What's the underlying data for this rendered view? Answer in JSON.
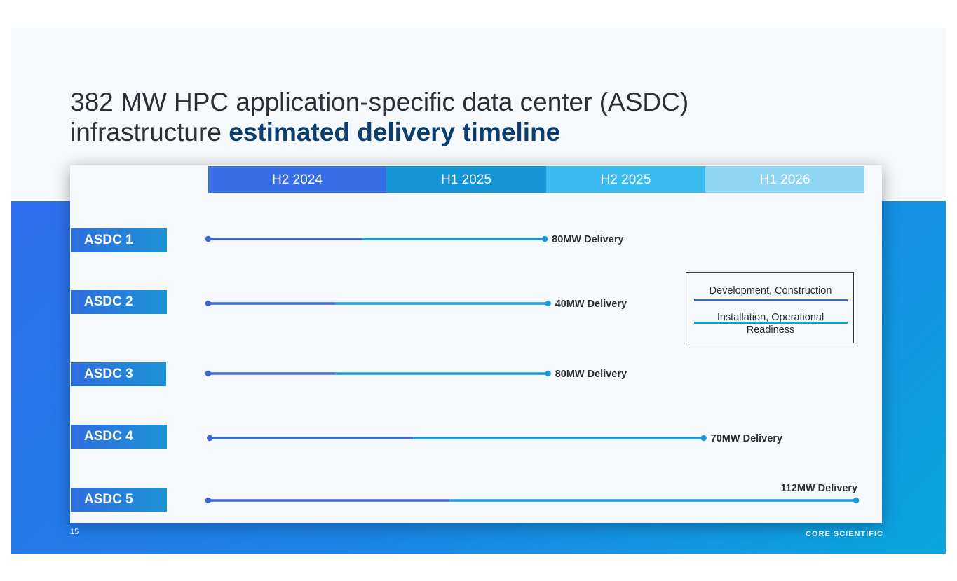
{
  "title": {
    "lead": "382 MW HPC application-specific data center (ASDC)",
    "rest": "infrastructure ",
    "bold": "estimated delivery timeline"
  },
  "periods": [
    "H2 2024",
    "H1 2025",
    "H2 2025",
    "H1 2026"
  ],
  "legend": {
    "phase1": "Development, Construction",
    "phase2": "Installation, Operational Readiness"
  },
  "colors": {
    "phase1": "#3a66d6",
    "phase2": "#1a9ad6",
    "period_fills": [
      "#356ee6",
      "#1496d6",
      "#3bbcf0",
      "#8ed6f4"
    ]
  },
  "chart_data": {
    "type": "timeline",
    "x_axis": {
      "categories": [
        "H2 2024",
        "H1 2025",
        "H2 2025",
        "H1 2026"
      ]
    },
    "rows": [
      {
        "label": "ASDC 1",
        "start": 0.0,
        "phase_switch": 0.97,
        "end": 2.12,
        "delivery": "80MW Delivery"
      },
      {
        "label": "ASDC 2",
        "start": 0.0,
        "phase_switch": 0.8,
        "end": 2.14,
        "delivery": "40MW Delivery"
      },
      {
        "label": "ASDC 3",
        "start": 0.0,
        "phase_switch": 0.8,
        "end": 2.14,
        "delivery": "80MW Delivery"
      },
      {
        "label": "ASDC 4",
        "start": 0.01,
        "phase_switch": 1.29,
        "end": 3.12,
        "delivery": "70MW Delivery"
      },
      {
        "label": "ASDC 5",
        "start": 0.0,
        "phase_switch": 1.52,
        "end": 4.08,
        "delivery": "112MW Delivery"
      }
    ]
  },
  "footer": {
    "page": "15",
    "brand": "CORE SCIENTIFIC"
  }
}
